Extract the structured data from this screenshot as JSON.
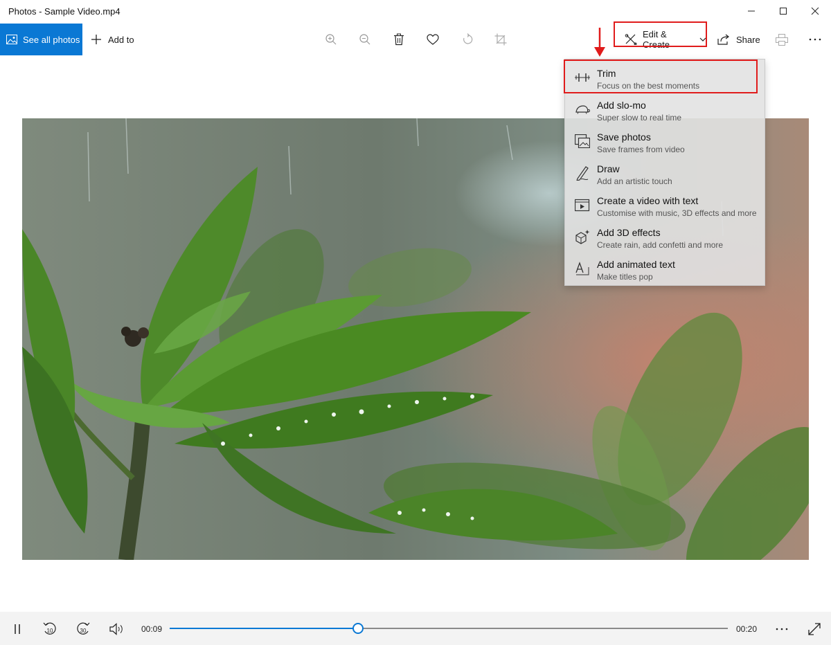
{
  "window": {
    "title": "Photos - Sample Video.mp4"
  },
  "toolbar": {
    "see_all_label": "See all photos",
    "add_to_label": "Add to",
    "edit_create_label": "Edit & Create",
    "share_label": "Share"
  },
  "menu": {
    "items": [
      {
        "title": "Trim",
        "subtitle": "Focus on the best moments",
        "icon": "trim-icon"
      },
      {
        "title": "Add slo-mo",
        "subtitle": "Super slow to real time",
        "icon": "turtle-icon"
      },
      {
        "title": "Save photos",
        "subtitle": "Save frames from video",
        "icon": "save-photos-icon"
      },
      {
        "title": "Draw",
        "subtitle": "Add an artistic touch",
        "icon": "draw-icon"
      },
      {
        "title": "Create a video with text",
        "subtitle": "Customise with music, 3D effects and more",
        "icon": "video-text-icon"
      },
      {
        "title": "Add 3D effects",
        "subtitle": "Create rain, add confetti and more",
        "icon": "3d-effects-icon"
      },
      {
        "title": "Add animated text",
        "subtitle": "Make titles pop",
        "icon": "animated-text-icon"
      }
    ]
  },
  "player": {
    "current_time": "00:09",
    "total_time": "00:20",
    "progress_fraction": 0.337,
    "skip_back_label": "10",
    "skip_forward_label": "30"
  },
  "colors": {
    "accent": "#0a78d4",
    "highlight": "#e01b1b"
  }
}
